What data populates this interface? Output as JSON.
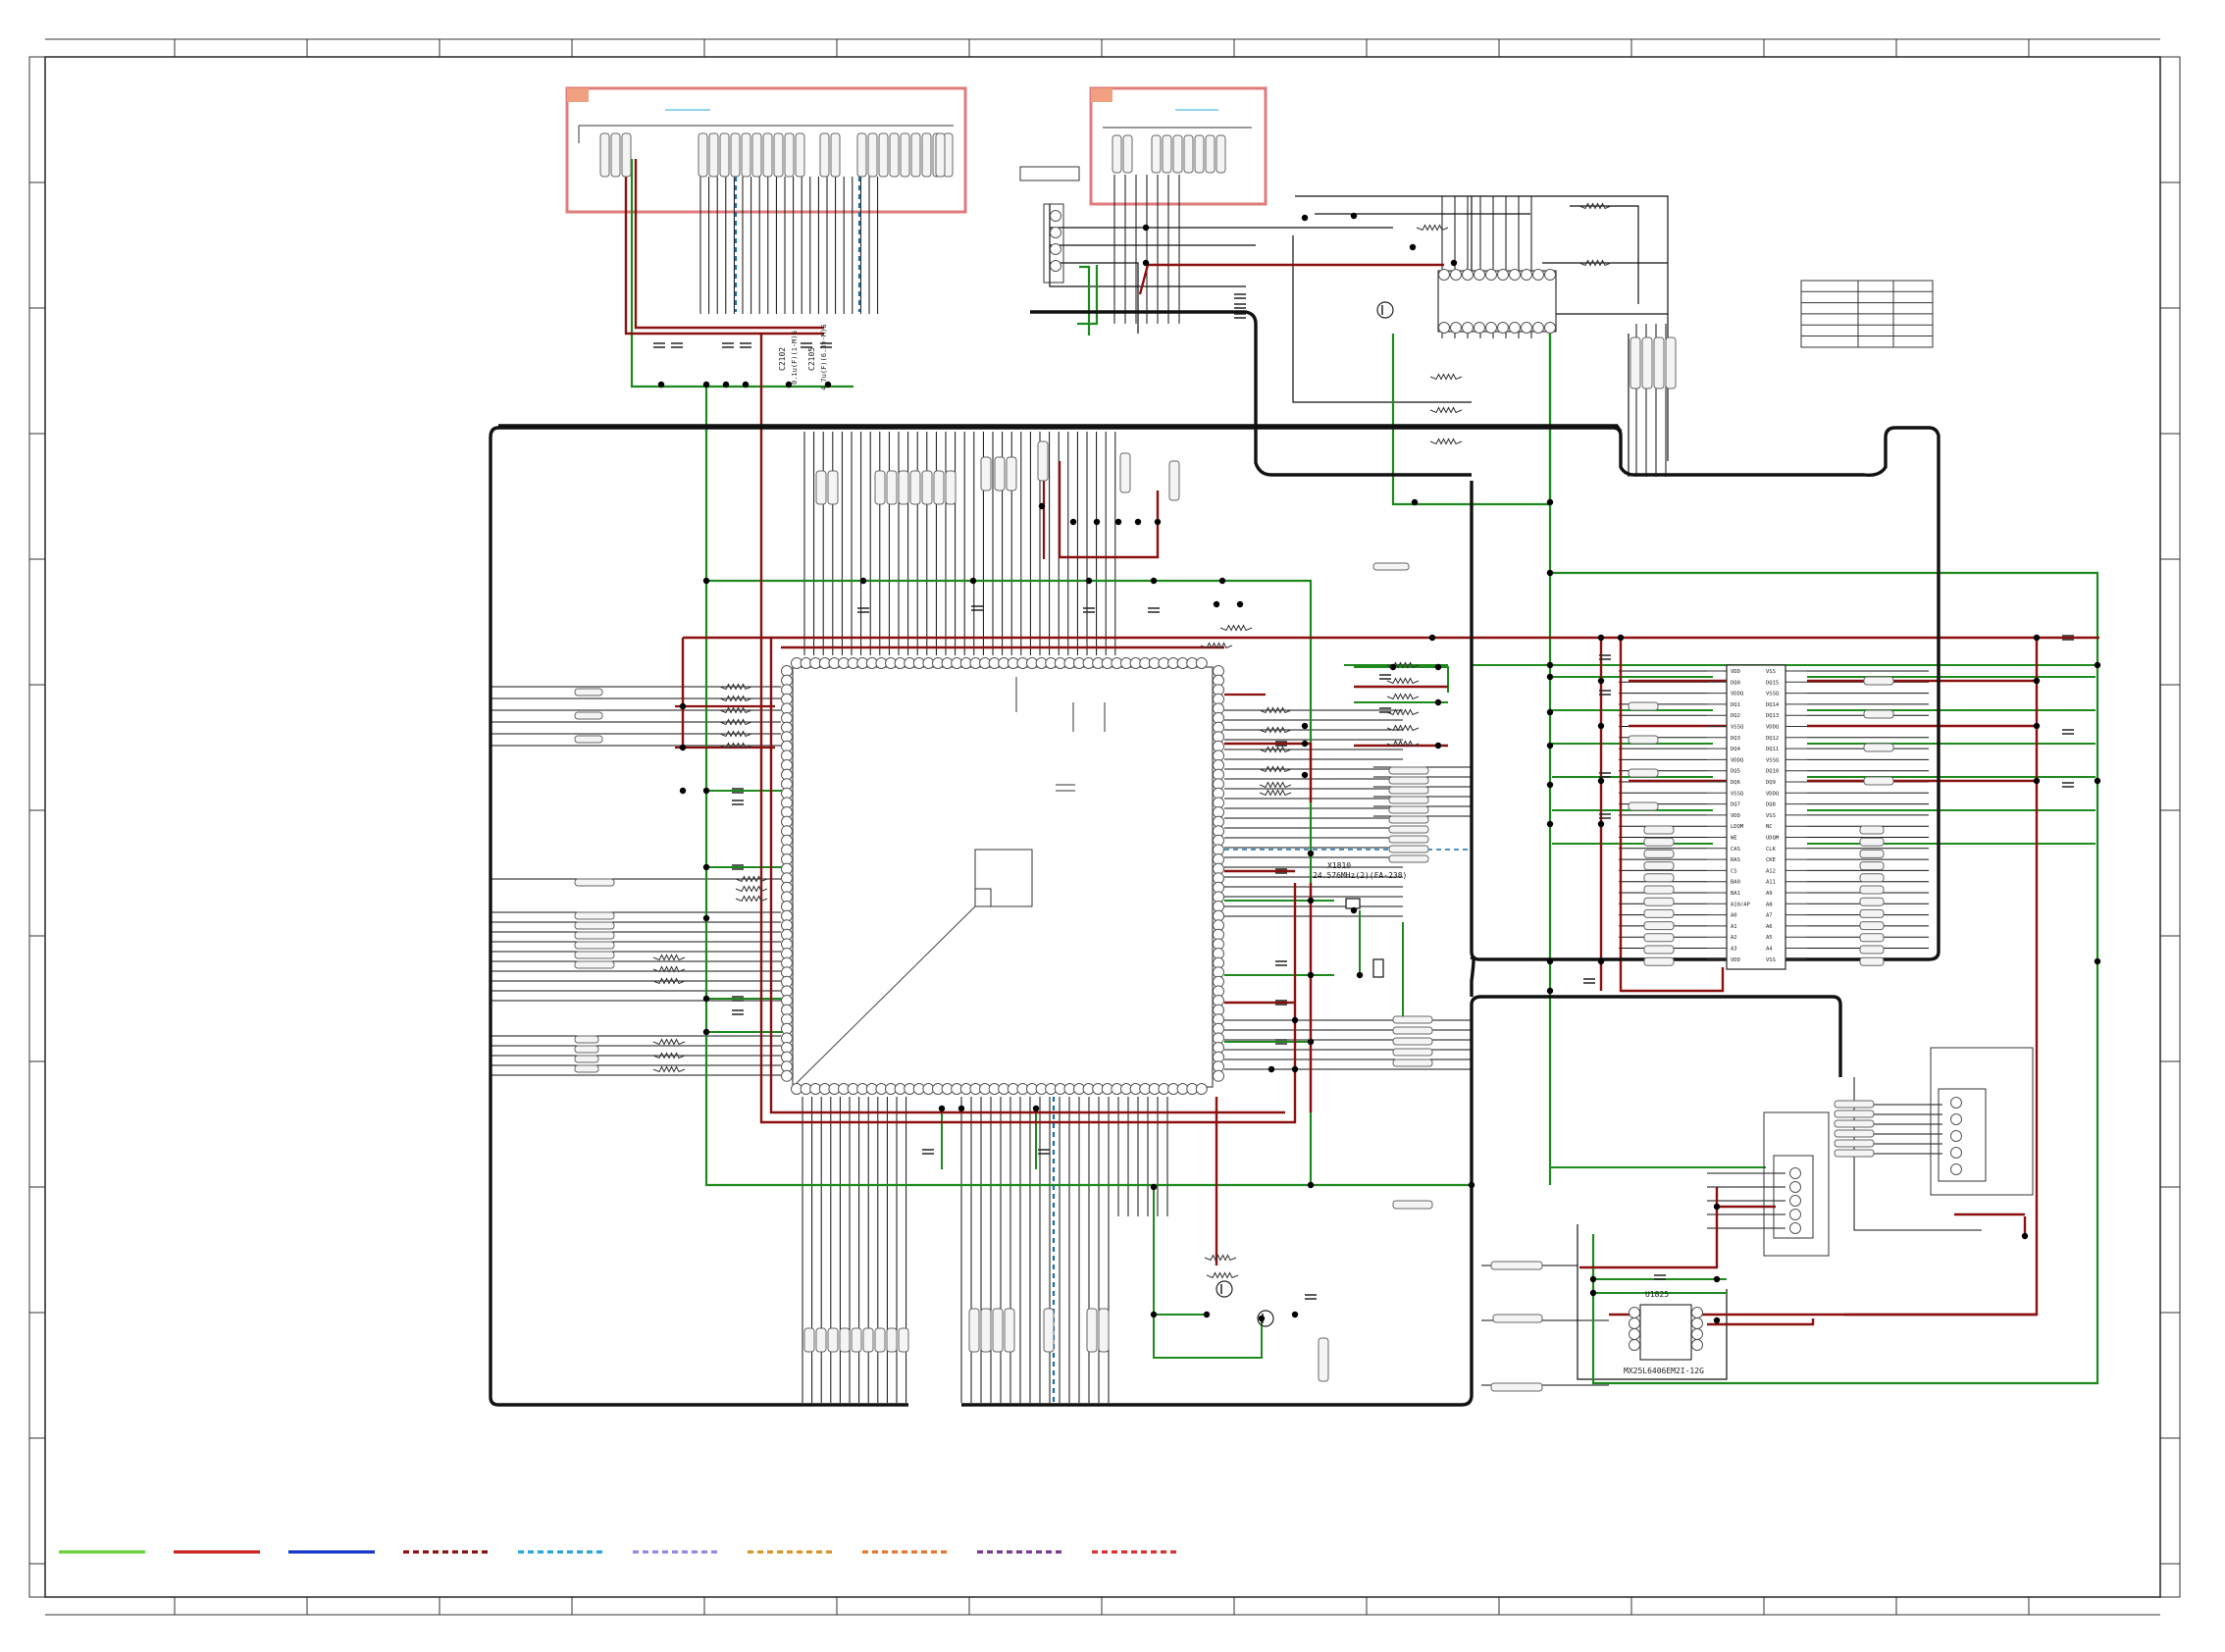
{
  "parts": {
    "cap_c2102": "C2102",
    "cap_c2102_value": "0.1u(F)(1-M)G",
    "cap_c2105": "C2105",
    "cap_c2105_value": "4.7u(F)(6.3v-M)G",
    "crystal_ref": "X1810",
    "crystal_value": "24.576MHz(2)(FA-238)",
    "flash_ref": "U1825",
    "flash_part": "MX25L6406EM2I-12G"
  },
  "sdram_pins": {
    "left": [
      "VDD",
      "DQ0",
      "VDDQ",
      "DQ1",
      "DQ2",
      "VSSQ",
      "DQ3",
      "DQ4",
      "VDDQ",
      "DQ5",
      "DQ6",
      "VSSQ",
      "DQ7",
      "VDD",
      "LDQM",
      "WE",
      "CAS",
      "RAS",
      "CS",
      "BA0",
      "BA1",
      "A10/AP",
      "A0",
      "A1",
      "A2",
      "A3",
      "VDD"
    ],
    "right": [
      "VSS",
      "DQ15",
      "VSSQ",
      "DQ14",
      "DQ13",
      "VDDQ",
      "DQ12",
      "DQ11",
      "VSSQ",
      "DQ10",
      "DQ9",
      "VDDQ",
      "DQ8",
      "VSS",
      "NC",
      "UDQM",
      "CLK",
      "CKE",
      "A12",
      "A11",
      "A9",
      "A8",
      "A7",
      "A6",
      "A5",
      "A4",
      "VSS"
    ]
  },
  "colors": {
    "gnd": "#1e8a1e",
    "power": "#8b1010",
    "bus": "#111111",
    "frame": "#333333",
    "connector_box": "#e07b7b",
    "shield": "#1b6fa8",
    "legend": [
      "#6ad23c",
      "#cc2222",
      "#1437c8",
      "#8b1010",
      "#2aa7d8",
      "#9a86e0",
      "#d8962c",
      "#e4782c",
      "#7a3c8c",
      "#d83232"
    ]
  }
}
